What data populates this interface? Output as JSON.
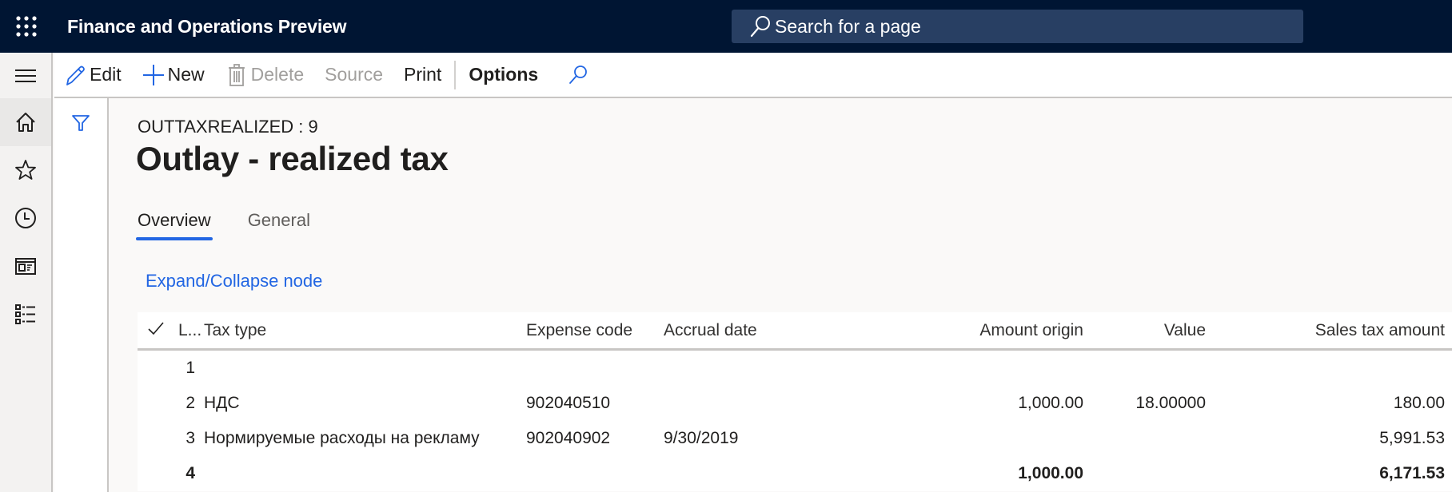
{
  "app": {
    "title": "Finance and Operations Preview",
    "search_placeholder": "Search for a page"
  },
  "leftnav": {
    "items": [
      {
        "name": "home",
        "icon": "home-icon"
      },
      {
        "name": "favorites",
        "icon": "star-icon"
      },
      {
        "name": "recent",
        "icon": "clock-icon"
      },
      {
        "name": "workspaces",
        "icon": "workspace-icon"
      },
      {
        "name": "modules",
        "icon": "list-icon"
      }
    ]
  },
  "actions": {
    "edit": "Edit",
    "new": "New",
    "delete": "Delete",
    "source": "Source",
    "print": "Print",
    "options": "Options"
  },
  "page": {
    "record_id": "OUTTAXREALIZED : 9",
    "title": "Outlay - realized tax",
    "tabs": [
      {
        "label": "Overview",
        "active": true
      },
      {
        "label": "General",
        "active": false
      }
    ],
    "expand_link": "Expand/Collapse node"
  },
  "grid": {
    "columns": {
      "line": "L...",
      "tax_type": "Tax type",
      "expense_code": "Expense code",
      "accrual_date": "Accrual date",
      "amount_origin": "Amount origin",
      "value": "Value",
      "sales_tax_amount": "Sales tax amount"
    },
    "rows": [
      {
        "line": "1",
        "tax_type": "",
        "expense_code": "",
        "accrual_date": "",
        "amount_origin": "",
        "value": "",
        "sales_tax_amount": ""
      },
      {
        "line": "2",
        "tax_type": "НДС",
        "expense_code": "902040510",
        "accrual_date": "",
        "amount_origin": "1,000.00",
        "value": "18.00000",
        "sales_tax_amount": "180.00"
      },
      {
        "line": "3",
        "tax_type": "Нормируемые расходы на рекламу",
        "expense_code": "902040902",
        "accrual_date": "9/30/2019",
        "amount_origin": "",
        "value": "",
        "sales_tax_amount": "5,991.53"
      },
      {
        "line": "4",
        "tax_type": "",
        "expense_code": "",
        "accrual_date": "",
        "amount_origin": "1,000.00",
        "value": "",
        "sales_tax_amount": "6,171.53"
      }
    ]
  },
  "colors": {
    "navbar": "#001533",
    "search_bg": "#283f63",
    "accent": "#2266e3",
    "disabled": "#a19f9d"
  }
}
